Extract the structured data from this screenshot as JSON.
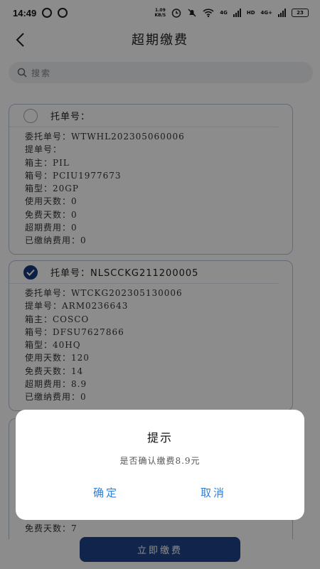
{
  "status_bar": {
    "time": "14:49",
    "net_speed_value": "1.09",
    "net_speed_unit": "KB/S",
    "network_tag": "4G",
    "hd_tag": "HD",
    "network_tag_2": "4G+",
    "battery": "23"
  },
  "header": {
    "title": "超期缴费"
  },
  "search": {
    "placeholder": "搜索"
  },
  "cards": [
    {
      "selected": false,
      "head": "托单号：",
      "rows": [
        "委托单号：WTWHL202305060006",
        "提单号：",
        "箱主：PIL",
        "箱号：PCIU1977673",
        "箱型：20GP",
        "使用天数：0",
        "免费天数：0",
        "超期费用：0",
        "已缴纳费用：0"
      ]
    },
    {
      "selected": true,
      "head": "托单号：NLSCCKG211200005",
      "rows": [
        "委托单号：WTCKG202305130006",
        "提单号：ARM0236643",
        "箱主：COSCO",
        "箱号：DFSU7627866",
        "箱型：40HQ",
        "使用天数：120",
        "免费天数：14",
        "超期费用：8.9",
        "已缴纳费用：0"
      ]
    },
    {
      "partial_row": "免费天数：7"
    }
  ],
  "bottom_button": {
    "label": "立即缴费"
  },
  "dialog": {
    "title": "提示",
    "message": "是否确认缴费8.9元",
    "confirm_label": "确定",
    "cancel_label": "取消"
  },
  "colors": {
    "primary": "#1e428a",
    "radio_selected": "#143a7c",
    "dialog_link": "#2f7fd8",
    "card_border": "#b9c2dc"
  }
}
